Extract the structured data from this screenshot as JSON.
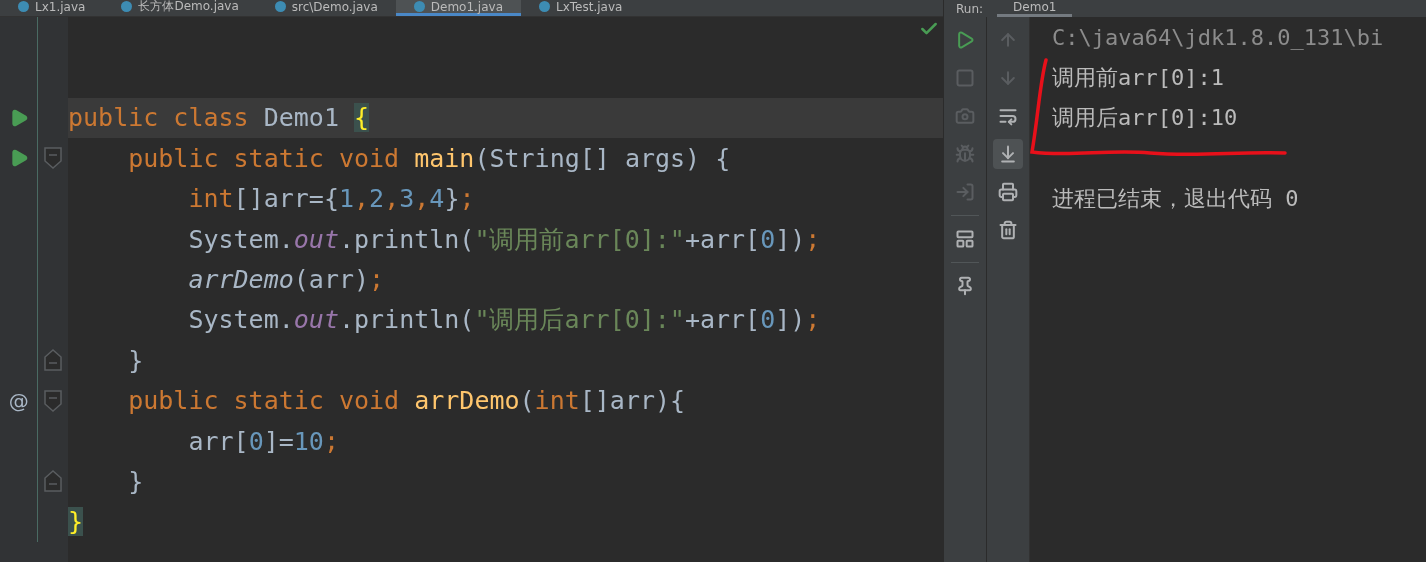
{
  "editor_tabs": [
    {
      "label": "Lx1.java",
      "selected": false
    },
    {
      "label": "长方体Demo.java",
      "selected": false
    },
    {
      "label": "src\\Demo.java",
      "selected": false
    },
    {
      "label": "Demo1.java",
      "selected": true
    },
    {
      "label": "LxTest.java",
      "selected": false
    }
  ],
  "run_panel": {
    "label": "Run:",
    "tab": "Demo1"
  },
  "code_lines": [
    {
      "current": false
    },
    {
      "current": false
    },
    {
      "gutter": {
        "kind": "run"
      },
      "current": true,
      "tokens": [
        {
          "text": "public class ",
          "kind": "keyword"
        },
        {
          "text": "Demo1 ",
          "kind": "plain"
        },
        {
          "text": "{",
          "kind": "brace"
        }
      ]
    },
    {
      "gutter": {
        "kind": "run"
      },
      "fold": {
        "kind": "start"
      },
      "current": false,
      "tokens": [
        {
          "text": "    public static void ",
          "kind": "keyword"
        },
        {
          "text": "main",
          "kind": "method"
        },
        {
          "text": "(String[] args) {",
          "kind": "plain"
        }
      ]
    },
    {
      "current": false,
      "tokens": [
        {
          "text": "        int",
          "kind": "keyword"
        },
        {
          "text": "[]arr={",
          "kind": "plain"
        },
        {
          "text": "1",
          "kind": "number"
        },
        {
          "text": ",",
          "kind": "keyword"
        },
        {
          "text": "2",
          "kind": "number"
        },
        {
          "text": ",",
          "kind": "keyword"
        },
        {
          "text": "3",
          "kind": "number"
        },
        {
          "text": ",",
          "kind": "keyword"
        },
        {
          "text": "4",
          "kind": "number"
        },
        {
          "text": "}",
          "kind": "plain"
        },
        {
          "text": ";",
          "kind": "keyword"
        }
      ]
    },
    {
      "current": false,
      "tokens": [
        {
          "text": "        System.",
          "kind": "plain"
        },
        {
          "text": "out",
          "kind": "field"
        },
        {
          "text": ".println(",
          "kind": "plain"
        },
        {
          "text": "\"调用前arr[0]:\"",
          "kind": "string"
        },
        {
          "text": "+arr[",
          "kind": "plain"
        },
        {
          "text": "0",
          "kind": "number"
        },
        {
          "text": "])",
          "kind": "plain"
        },
        {
          "text": ";",
          "kind": "keyword"
        }
      ]
    },
    {
      "current": false,
      "tokens": [
        {
          "text": "        arrDemo",
          "kind": "call"
        },
        {
          "text": "(arr)",
          "kind": "plain"
        },
        {
          "text": ";",
          "kind": "keyword"
        }
      ]
    },
    {
      "current": false,
      "tokens": [
        {
          "text": "        System.",
          "kind": "plain"
        },
        {
          "text": "out",
          "kind": "field"
        },
        {
          "text": ".println(",
          "kind": "plain"
        },
        {
          "text": "\"调用后arr[0]:\"",
          "kind": "string"
        },
        {
          "text": "+arr[",
          "kind": "plain"
        },
        {
          "text": "0",
          "kind": "number"
        },
        {
          "text": "])",
          "kind": "plain"
        },
        {
          "text": ";",
          "kind": "keyword"
        }
      ]
    },
    {
      "fold": {
        "kind": "end"
      },
      "current": false,
      "tokens": [
        {
          "text": "    }",
          "kind": "plain"
        }
      ]
    },
    {
      "gutter": {
        "kind": "override",
        "text": "@"
      },
      "fold": {
        "kind": "start"
      },
      "current": false,
      "tokens": [
        {
          "text": "    public static void ",
          "kind": "keyword"
        },
        {
          "text": "arrDemo",
          "kind": "method"
        },
        {
          "text": "(",
          "kind": "plain"
        },
        {
          "text": "int",
          "kind": "keyword"
        },
        {
          "text": "[]arr){",
          "kind": "plain"
        }
      ]
    },
    {
      "current": false,
      "tokens": [
        {
          "text": "        arr[",
          "kind": "plain"
        },
        {
          "text": "0",
          "kind": "number"
        },
        {
          "text": "]=",
          "kind": "plain"
        },
        {
          "text": "10",
          "kind": "number"
        },
        {
          "text": ";",
          "kind": "keyword"
        }
      ]
    },
    {
      "fold": {
        "kind": "end"
      },
      "current": false,
      "tokens": [
        {
          "text": "    }",
          "kind": "plain"
        }
      ]
    },
    {
      "current": false,
      "tokens": [
        {
          "text": "}",
          "kind": "brace"
        }
      ]
    }
  ],
  "console": {
    "lines": [
      {
        "kind": "command",
        "text": "C:\\java64\\jdk1.8.0_131\\bi"
      },
      {
        "kind": "output",
        "text": "调用前arr[0]:1"
      },
      {
        "kind": "output",
        "text": "调用后arr[0]:10"
      },
      {
        "kind": "blank"
      },
      {
        "kind": "output",
        "text": "进程已结束，退出代码 0"
      }
    ]
  }
}
